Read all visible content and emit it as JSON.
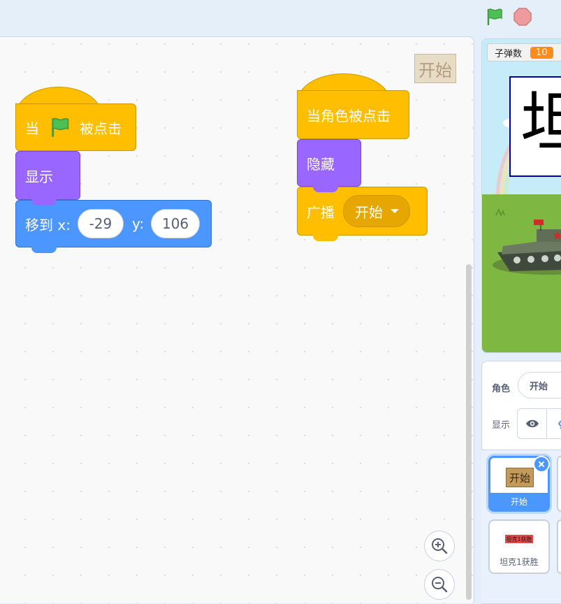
{
  "topbar": {
    "green_flag_icon": "green-flag-icon",
    "stop_icon": "stop-sign-icon"
  },
  "workspace": {
    "sprite_label": "开始",
    "script1": {
      "hat_prefix": "当",
      "hat_suffix": "被点击",
      "show_label": "显示",
      "goto_label": "移到 x:",
      "goto_y_label": "y:",
      "x_value": "-29",
      "y_value": "106"
    },
    "script2": {
      "hat_label": "当角色被点击",
      "hide_label": "隐藏",
      "broadcast_label": "广播",
      "broadcast_value": "开始"
    }
  },
  "stage": {
    "monitor_label": "子弹数",
    "monitor_value": "10",
    "big_text": "坦"
  },
  "sprite_info": {
    "sprite_label": "角色",
    "sprite_name": "开始",
    "show_label": "显示"
  },
  "sprites": [
    {
      "name": "开始",
      "thumb_text": "开始",
      "selected": true
    },
    {
      "name": "坦克1获胜",
      "thumb_text": "坦克1获胜",
      "selected": false
    }
  ],
  "colors": {
    "events": "#ffbf00",
    "looks": "#9966ff",
    "motion": "#4c97ff",
    "accent": "#4c97ff"
  }
}
